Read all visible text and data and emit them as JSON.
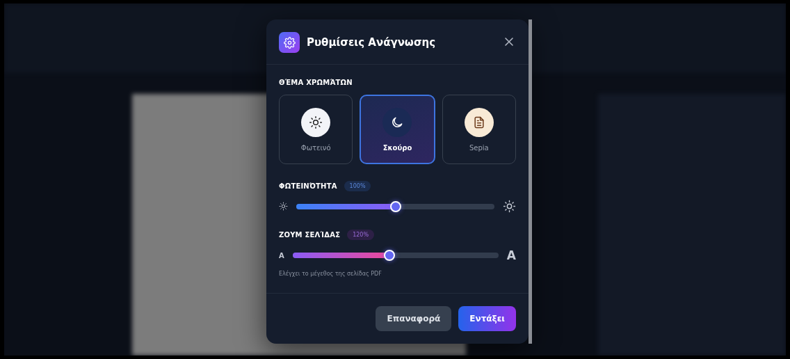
{
  "dialog": {
    "title": "Ρυθμίσεις Ανάγνωσης"
  },
  "theme_section": {
    "label": "ΘΈΜΑ ΧΡΩΜΆΤΩΝ",
    "themes": [
      {
        "kind": "light",
        "label": "Φωτεινό",
        "selected": false
      },
      {
        "kind": "dark",
        "label": "Σκούρο",
        "selected": true
      },
      {
        "kind": "sepia",
        "label": "Sepia",
        "selected": false
      }
    ]
  },
  "sliders": [
    {
      "kind": "brightness",
      "label": "ΦΩΤΕΙΝΌΤΗΤΑ",
      "value": "100%",
      "level": 0.5
    },
    {
      "kind": "zoom",
      "label": "ΖΟΥΜ ΣΕΛΊΔΑΣ",
      "value": "120%",
      "level": 0.47,
      "min_label": "A",
      "max_label": "A",
      "help": "Ελέγχει το μέγεθος της σελίδας PDF"
    }
  ],
  "buttons": [
    {
      "kind": "secondary",
      "label": "Επαναφορά"
    },
    {
      "kind": "primary",
      "label": "Εντάξει"
    }
  ]
}
